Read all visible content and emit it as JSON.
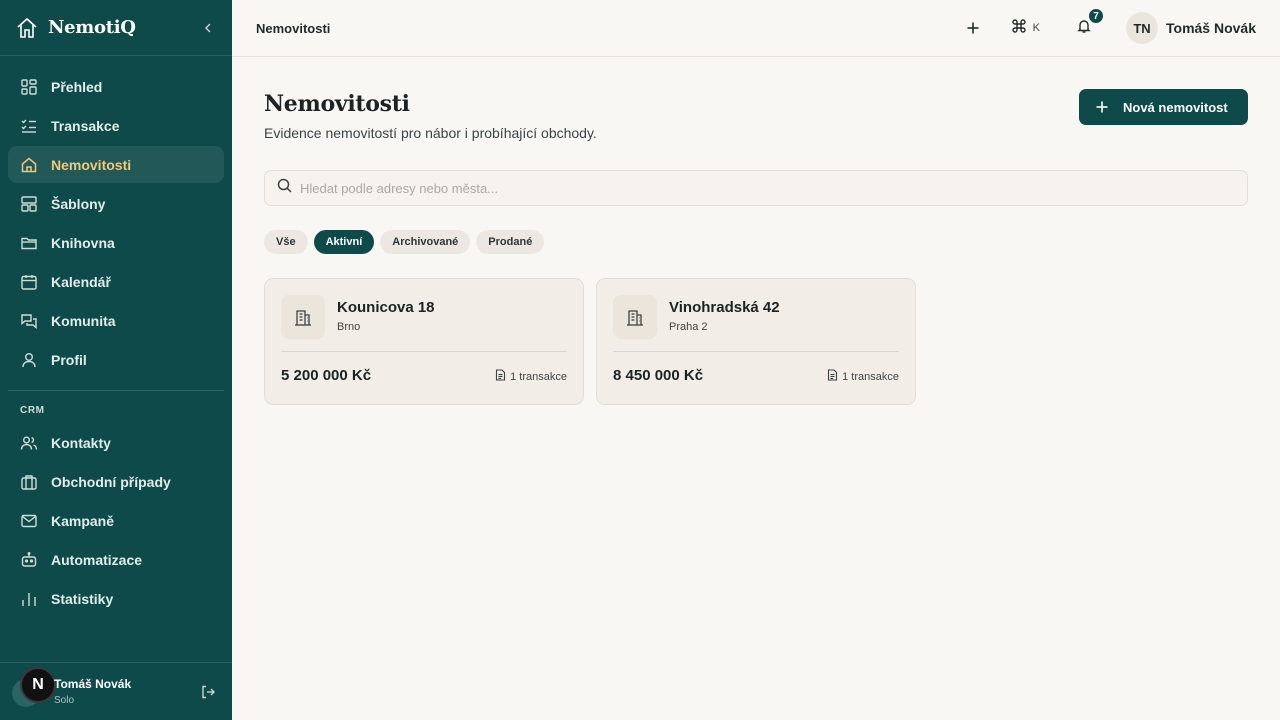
{
  "app": {
    "name": "NemotiQ"
  },
  "sidebar": {
    "items": [
      {
        "label": "Přehled",
        "icon": "grid-icon"
      },
      {
        "label": "Transakce",
        "icon": "list-check-icon"
      },
      {
        "label": "Nemovitosti",
        "icon": "home-icon",
        "active": true
      },
      {
        "label": "Šablony",
        "icon": "template-icon"
      },
      {
        "label": "Knihovna",
        "icon": "folder-icon"
      },
      {
        "label": "Kalendář",
        "icon": "calendar-icon"
      },
      {
        "label": "Komunita",
        "icon": "chat-icon"
      },
      {
        "label": "Profil",
        "icon": "user-icon"
      }
    ],
    "crm_section": "CRM",
    "crm_items": [
      {
        "label": "Kontakty",
        "icon": "users-icon"
      },
      {
        "label": "Obchodní případy",
        "icon": "briefcase-icon"
      },
      {
        "label": "Kampaně",
        "icon": "mail-icon"
      },
      {
        "label": "Automatizace",
        "icon": "bot-icon"
      },
      {
        "label": "Statistiky",
        "icon": "bar-chart-icon"
      }
    ],
    "footer": {
      "user_name": "Tomáš Novák",
      "role": "Solo",
      "badge": "N"
    }
  },
  "header": {
    "breadcrumb": "Nemovitosti",
    "shortcut_key": "K",
    "notification_count": "7",
    "user_initials": "TN",
    "user_name": "Tomáš Novák"
  },
  "main": {
    "title": "Nemovitosti",
    "subtitle": "Evidence nemovitostí pro nábor i probíhající obchody.",
    "new_button": "Nová nemovitost",
    "search_placeholder": "Hledat podle adresy nebo města...",
    "filters": [
      {
        "label": "Vše",
        "active": false
      },
      {
        "label": "Aktivní",
        "active": true
      },
      {
        "label": "Archivované",
        "active": false
      },
      {
        "label": "Prodané",
        "active": false
      }
    ],
    "properties": [
      {
        "address": "Kounicova 18",
        "city": "Brno",
        "price": "5 200 000 Kč",
        "transactions": "1 transakce"
      },
      {
        "address": "Vinohradská 42",
        "city": "Praha 2",
        "price": "8 450 000 Kč",
        "transactions": "1 transakce"
      }
    ]
  },
  "colors": {
    "primary": "#0f4a4a",
    "accent": "#f2c87a",
    "background": "#f9f7f3"
  }
}
